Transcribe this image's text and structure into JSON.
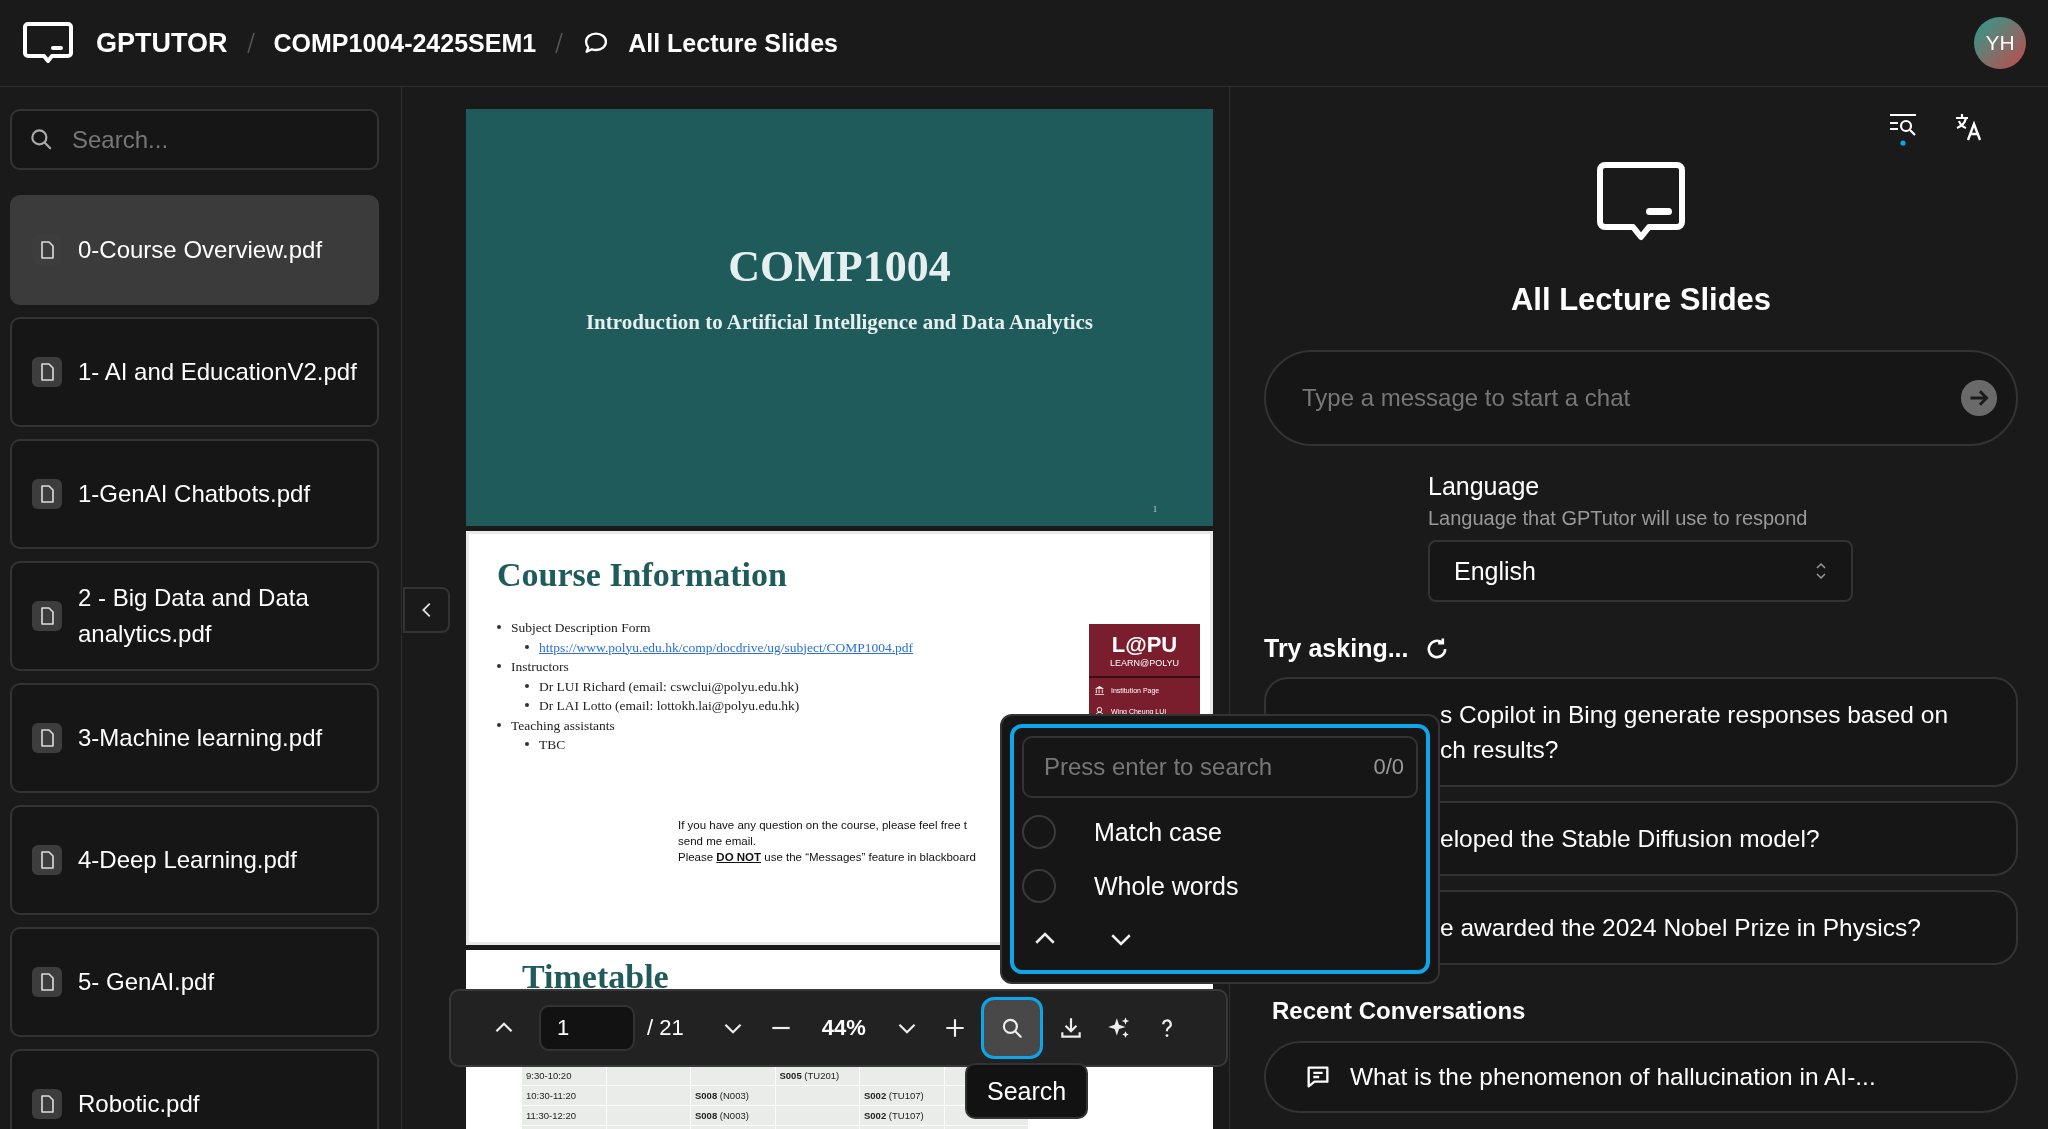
{
  "header": {
    "brand": "GPTUTOR",
    "course": "COMP1004-2425SEM1",
    "page": "All Lecture Slides",
    "avatar": "YH"
  },
  "sidebar": {
    "search": {
      "placeholder": "Search..."
    },
    "files": [
      {
        "name": "0-Course Overview.pdf",
        "selected": true
      },
      {
        "name": "1- AI and EducationV2.pdf",
        "selected": false
      },
      {
        "name": "1-GenAI Chatbots.pdf",
        "selected": false
      },
      {
        "name": "2 - Big Data and Data analytics.pdf",
        "selected": false
      },
      {
        "name": "3-Machine learning.pdf",
        "selected": false
      },
      {
        "name": "4-Deep Learning.pdf",
        "selected": false
      },
      {
        "name": "5- GenAI.pdf",
        "selected": false
      },
      {
        "name": "Robotic.pdf",
        "selected": false
      }
    ]
  },
  "viewer": {
    "pages": [
      {
        "kind": "title",
        "title": "COMP1004",
        "subtitle": "Introduction to Artificial Intelligence and Data Analytics",
        "page_number": "1"
      },
      {
        "kind": "content",
        "title": "Course Information",
        "bullets": [
          {
            "text": "Subject Description Form",
            "children": [
              {
                "text": "https://www.polyu.edu.hk/comp/docdrive/ug/subject/COMP1004.pdf",
                "link": true
              }
            ]
          },
          {
            "text": "Instructors",
            "children": [
              {
                "text": "Dr LUI Richard  (email: cswclui@polyu.edu.hk)",
                "link": false
              },
              {
                "text": "Dr LAI Lotto (email: lottokh.lai@polyu.edu.hk)",
                "link": false
              }
            ]
          },
          {
            "text": "Teaching assistants",
            "children": [
              {
                "text": "TBC",
                "link": false
              }
            ]
          }
        ],
        "badge": {
          "logo": "L@PU",
          "tagline": "LEARN@POLYU",
          "links": [
            "Institution Page",
            "Wing Cheung LUI"
          ]
        },
        "note": [
          "If you have any question on the course, please feel free t",
          "send me email.",
          "Please **DO NOT** use the “Messages” feature in blackboard"
        ]
      },
      {
        "kind": "table",
        "title": "Timetable",
        "rows": [
          [
            "9:30-10:20",
            "",
            "",
            "**S005** (TU201)",
            "",
            ""
          ],
          [
            "10:30-11:20",
            "",
            "**S008** (N003)",
            "",
            "**S002** (TU107)",
            ""
          ],
          [
            "11:30-12:20",
            "",
            "**S008** (N003)",
            "",
            "**S002** (TU107)",
            ""
          ]
        ]
      }
    ],
    "toolbar": {
      "page": "1",
      "page_count": "/ 21",
      "zoom": "44%",
      "search_selected": true
    },
    "search_popup": {
      "placeholder": "Press enter to search",
      "count": "0/0",
      "options": [
        {
          "label": "Match case",
          "checked": false
        },
        {
          "label": "Whole words",
          "checked": false
        }
      ]
    },
    "tooltip": "Search"
  },
  "chat": {
    "title": "All Lecture Slides",
    "input": {
      "placeholder": "Type a message to start a chat"
    },
    "language": {
      "label": "Language",
      "description": "Language that GPTutor will use to respond",
      "value": "English"
    },
    "try_asking": "Try asking...",
    "suggestions": [
      {
        "lines": [
          "s Copilot in Bing generate responses based on",
          "ch results?"
        ]
      },
      {
        "lines": [
          "eloped the Stable Diffusion model?"
        ]
      },
      {
        "lines": [
          "e awarded the 2024 Nobel Prize in Physics?"
        ]
      }
    ],
    "recent": {
      "title": "Recent Conversations",
      "items": [
        "What is the phenomenon of hallucination in AI-..."
      ]
    }
  }
}
